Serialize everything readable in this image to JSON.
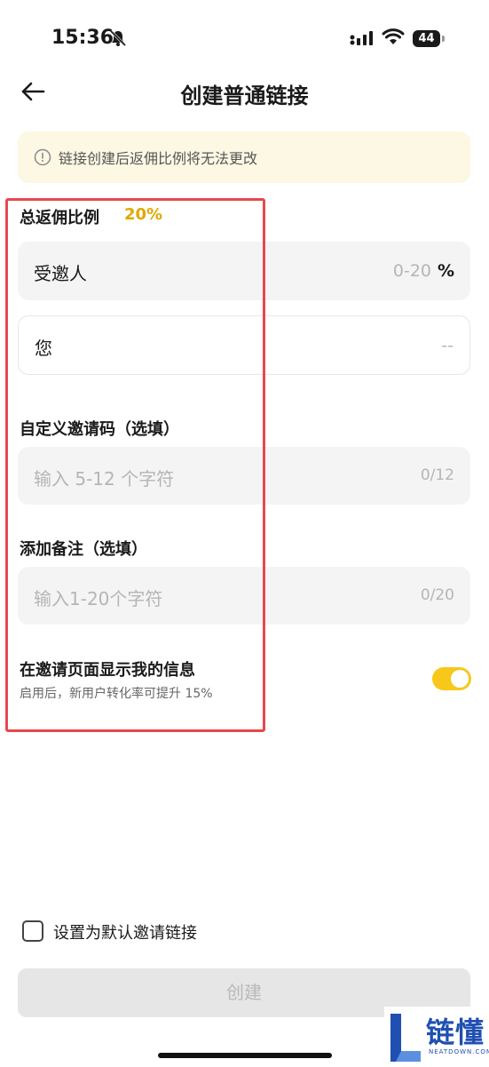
{
  "status_bar": {
    "time": "15:36",
    "battery": "44"
  },
  "header": {
    "title": "创建普通链接"
  },
  "notice": {
    "text": "链接创建后返佣比例将无法更改"
  },
  "commission": {
    "title": "总返佣比例",
    "rate": "20%",
    "invitee_label": "受邀人",
    "invitee_range": "0-20",
    "invitee_unit": "%",
    "you_label": "您",
    "you_value": "--"
  },
  "custom_code": {
    "title": "自定义邀请码（选填）",
    "placeholder": "输入 5-12 个字符",
    "counter": "0/12"
  },
  "remark": {
    "title": "添加备注（选填）",
    "placeholder": "输入1-20个字符",
    "counter": "0/20"
  },
  "show_info": {
    "title": "在邀请页面显示我的信息",
    "subtitle": "启用后，新用户转化率可提升 15%",
    "enabled": true
  },
  "default_link": {
    "label": "设置为默认邀请链接",
    "checked": false
  },
  "create_button": {
    "label": "创建"
  },
  "watermark": {
    "text": "链懂",
    "sub": "NEATDOWN.COM"
  },
  "colors": {
    "accent": "#f7c71a",
    "rate": "#e0a800",
    "highlight_box": "#e8474e",
    "notice_bg": "#fdf8e4"
  }
}
